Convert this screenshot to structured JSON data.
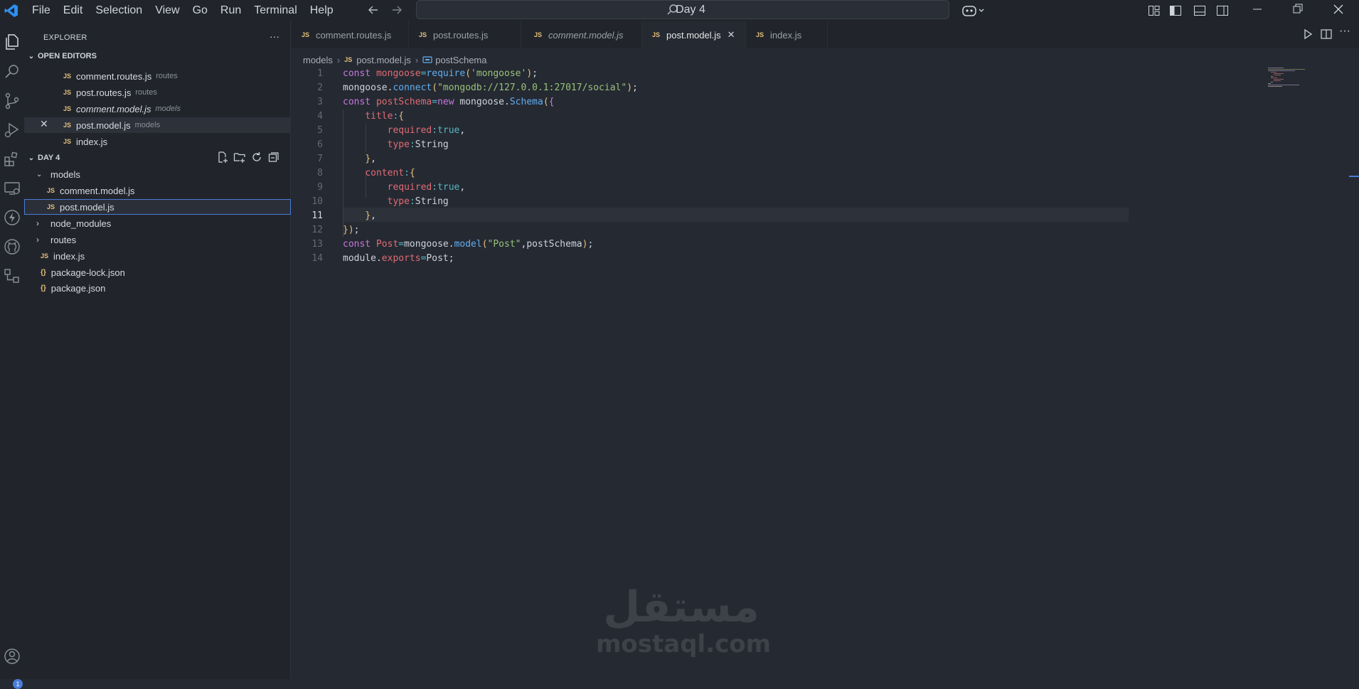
{
  "menu": [
    "File",
    "Edit",
    "Selection",
    "View",
    "Go",
    "Run",
    "Terminal",
    "Help"
  ],
  "command_center": {
    "label": "Day 4"
  },
  "explorer": {
    "title": "EXPLORER",
    "open_editors": {
      "label": "OPEN EDITORS",
      "items": [
        {
          "name": "comment.routes.js",
          "hint": "routes",
          "italic": false
        },
        {
          "name": "post.routes.js",
          "hint": "routes",
          "italic": false
        },
        {
          "name": "comment.model.js",
          "hint": "models",
          "italic": true
        },
        {
          "name": "post.model.js",
          "hint": "models",
          "italic": false,
          "active": true
        },
        {
          "name": "index.js",
          "hint": "",
          "italic": false
        }
      ]
    },
    "workspace": {
      "label": "DAY 4",
      "tree": [
        {
          "name": "models",
          "type": "folder",
          "expanded": true
        },
        {
          "name": "comment.model.js",
          "type": "js",
          "depth": 1
        },
        {
          "name": "post.model.js",
          "type": "js",
          "depth": 1,
          "selected": true
        },
        {
          "name": "node_modules",
          "type": "folder",
          "expanded": false
        },
        {
          "name": "routes",
          "type": "folder",
          "expanded": false
        },
        {
          "name": "index.js",
          "type": "js"
        },
        {
          "name": "package-lock.json",
          "type": "json"
        },
        {
          "name": "package.json",
          "type": "json"
        }
      ]
    }
  },
  "tabs": [
    {
      "label": "comment.routes.js",
      "italic": false
    },
    {
      "label": "post.routes.js",
      "italic": false
    },
    {
      "label": "comment.model.js",
      "italic": true
    },
    {
      "label": "post.model.js",
      "italic": false,
      "active": true
    },
    {
      "label": "index.js",
      "italic": false
    }
  ],
  "breadcrumb": {
    "folder": "models",
    "file": "post.model.js",
    "symbol": "postSchema"
  },
  "editor": {
    "current_line": 11,
    "line_numbers": [
      "1",
      "2",
      "3",
      "4",
      "5",
      "6",
      "7",
      "8",
      "9",
      "10",
      "11",
      "12",
      "13",
      "14"
    ],
    "lines": [
      "const mongoose=require('mongoose');",
      "mongoose.connect(\"mongodb://127.0.0.1:27017/social\");",
      "const postSchema=new mongoose.Schema({",
      "    title:{",
      "        required:true,",
      "        type:String",
      "    },",
      "    content:{",
      "        required:true,",
      "        type:String",
      "    },",
      "});",
      "const Post=mongoose.model(\"Post\",postSchema);",
      "module.exports=Post;"
    ]
  },
  "accounts_badge": "1",
  "watermark": {
    "arabic": "مستقل",
    "latin": "mostaql.com"
  },
  "colors": {
    "accent": "#4a7bd8",
    "keyword": "#c678dd",
    "variable": "#e06c75",
    "function": "#61afef",
    "string": "#98c379",
    "js_icon": "#e5c07b"
  }
}
